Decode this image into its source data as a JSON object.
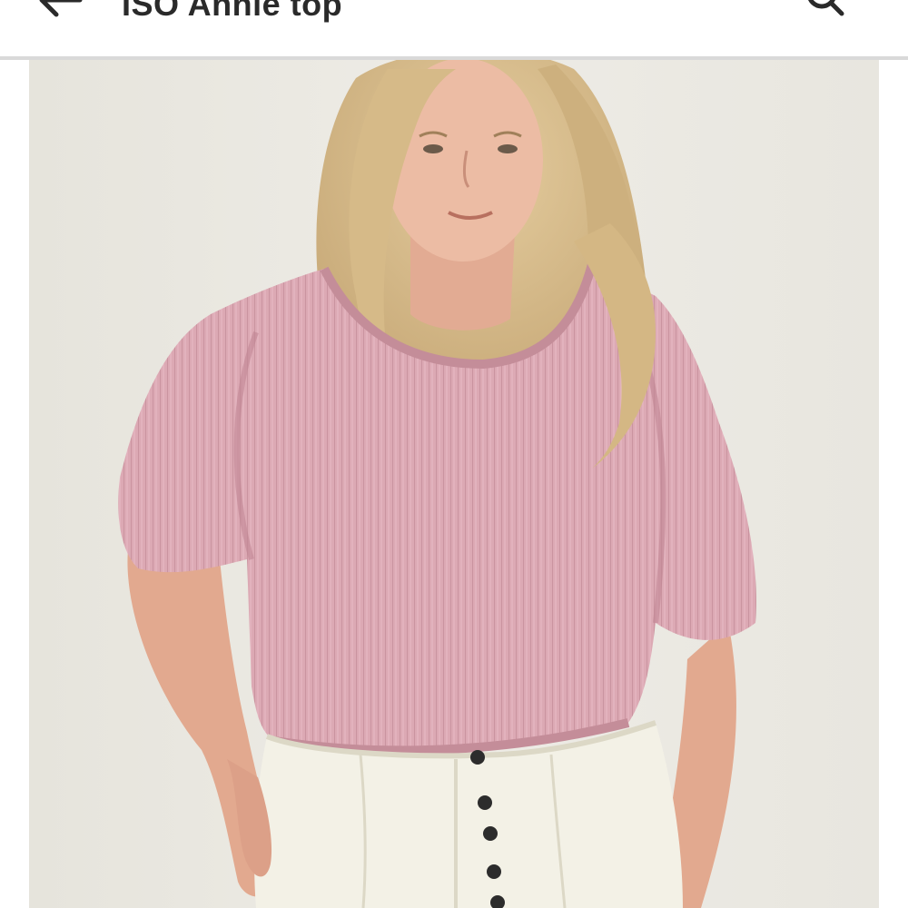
{
  "header": {
    "title": "ISO Annie top",
    "back_icon": "arrow-left-icon",
    "search_icon": "search-icon"
  },
  "photo": {
    "subject": "product-photo",
    "colors": {
      "background": "#e9e7e0",
      "top": "#dca9b4",
      "pants": "#f3f1e6",
      "hair": "#d8bd8c",
      "skin": "#e9b79f",
      "buttons": "#2c2c2c"
    }
  }
}
